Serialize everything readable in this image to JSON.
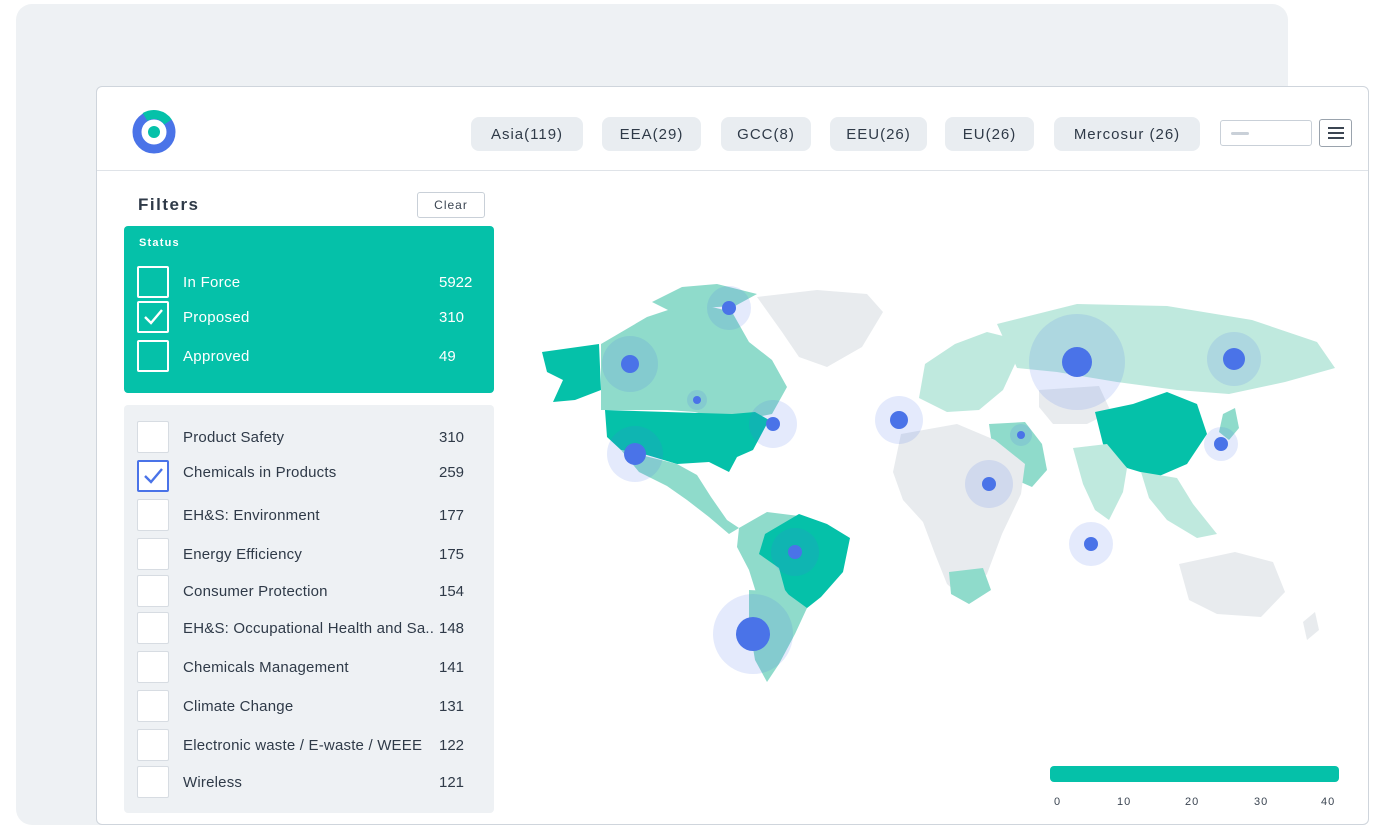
{
  "regions": [
    {
      "label": "Asia(119)"
    },
    {
      "label": "EEA(29)"
    },
    {
      "label": "GCC(8)"
    },
    {
      "label": "EEU(26)"
    },
    {
      "label": "EU(26)"
    },
    {
      "label": "Mercosur (26)"
    }
  ],
  "filters": {
    "title": "Filters",
    "clear_label": "Clear",
    "status": {
      "heading": "Status",
      "items": [
        {
          "label": "In Force",
          "count": "5922",
          "checked": false
        },
        {
          "label": "Proposed",
          "count": "310",
          "checked": true
        },
        {
          "label": "Approved",
          "count": "49",
          "checked": false
        }
      ]
    },
    "categories": [
      {
        "label": "Product Safety",
        "count": "310",
        "checked": false
      },
      {
        "label": "Chemicals in Products",
        "count": "259",
        "checked": true
      },
      {
        "label": "EH&S: Environment",
        "count": "177",
        "checked": false
      },
      {
        "label": "Energy Efficiency",
        "count": "175",
        "checked": false
      },
      {
        "label": "Consumer Protection",
        "count": "154",
        "checked": false
      },
      {
        "label": "EH&S: Occupational Health and Sa..",
        "count": "148",
        "checked": false
      },
      {
        "label": "Chemicals Management",
        "count": "141",
        "checked": false
      },
      {
        "label": "Climate Change",
        "count": "131",
        "checked": false
      },
      {
        "label": "Electronic waste / E-waste / WEEE",
        "count": "122",
        "checked": false
      },
      {
        "label": "Wireless",
        "count": "121",
        "checked": false
      }
    ]
  },
  "legend": {
    "ticks": [
      "0",
      "10",
      "20",
      "30",
      "40"
    ]
  },
  "colors": {
    "accent": "#05c1a9",
    "marker": "#4a73e8",
    "panel": "#eef1f4"
  }
}
